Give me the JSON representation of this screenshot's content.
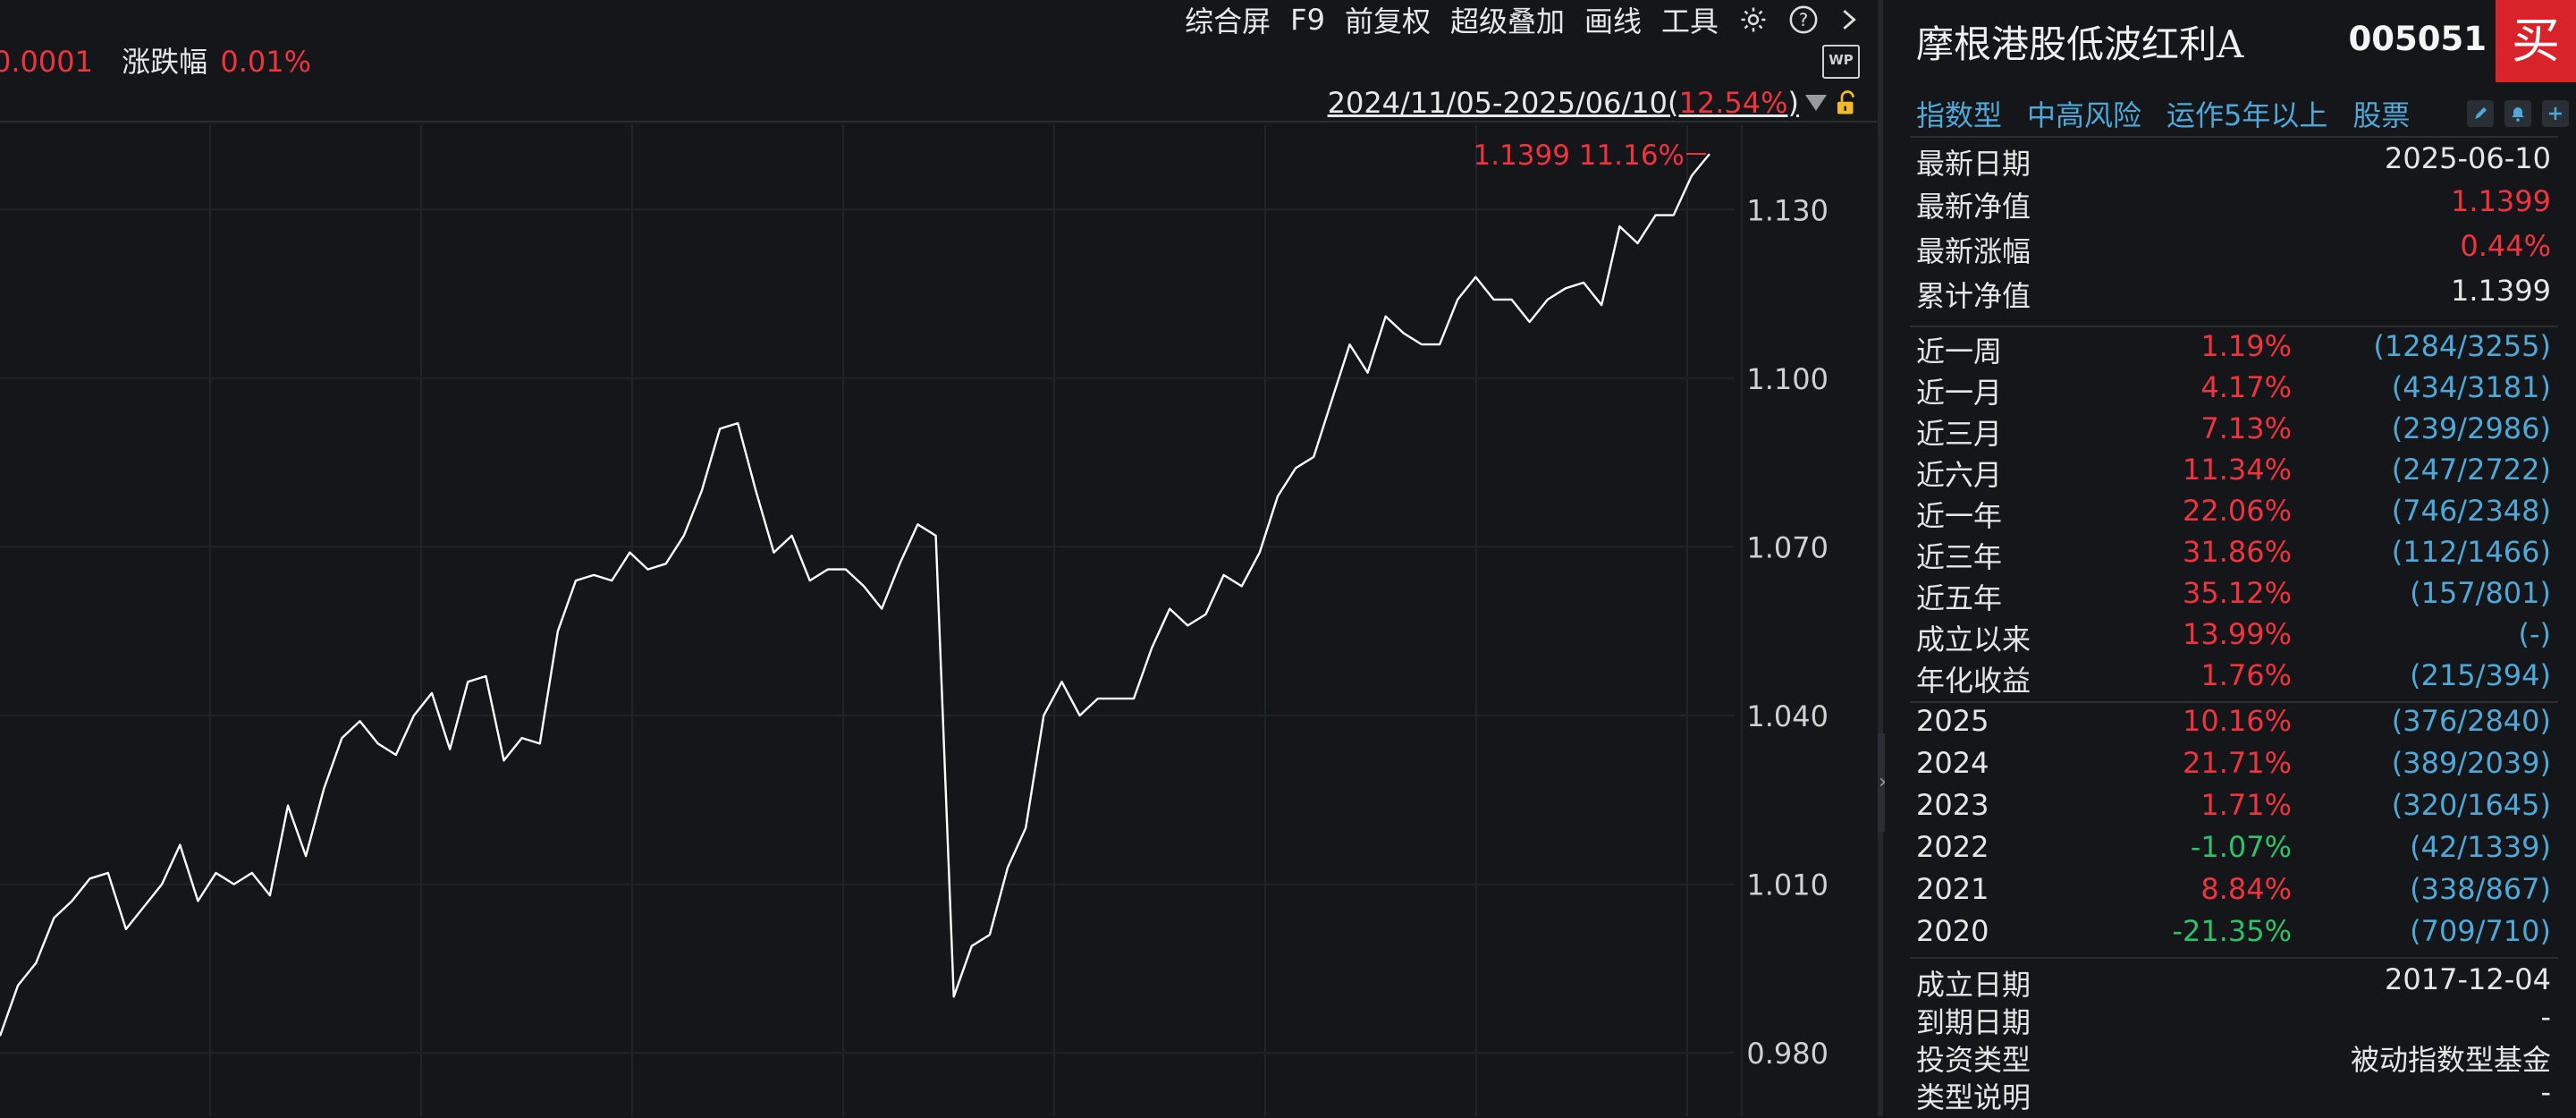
{
  "toolbar": {
    "items": [
      "综合屏",
      "F9",
      "前复权",
      "超级叠加",
      "画线",
      "工具"
    ]
  },
  "stats_line": {
    "value_label": "0.0001",
    "change_label": "涨跌幅",
    "change_value": "0.01%"
  },
  "wp_badge": "WP",
  "range": {
    "dates": "2024/11/05-2025/06/10(",
    "pct": "12.54%",
    "close": ")"
  },
  "chart_data": {
    "type": "line",
    "ylim": [
      0.97,
      1.145
    ],
    "yticks": [
      "1.130",
      "1.100",
      "1.070",
      "1.040",
      "1.010",
      "0.980"
    ],
    "ytick_values": [
      1.13,
      1.1,
      1.07,
      1.04,
      1.01,
      0.98
    ],
    "last_label": "1.1399 11.16%",
    "series": [
      {
        "values": [
          0.983,
          0.992,
          0.996,
          1.004,
          1.007,
          1.011,
          1.012,
          1.002,
          1.006,
          1.01,
          1.017,
          1.007,
          1.012,
          1.01,
          1.012,
          1.008,
          1.024,
          1.015,
          1.027,
          1.036,
          1.039,
          1.035,
          1.033,
          1.04,
          1.044,
          1.034,
          1.046,
          1.047,
          1.032,
          1.036,
          1.035,
          1.055,
          1.064,
          1.065,
          1.064,
          1.069,
          1.066,
          1.067,
          1.072,
          1.08,
          1.091,
          1.092,
          1.08,
          1.069,
          1.072,
          1.064,
          1.066,
          1.066,
          1.063,
          1.059,
          1.067,
          1.074,
          1.072,
          0.99,
          0.999,
          1.001,
          1.013,
          1.02,
          1.04,
          1.046,
          1.04,
          1.043,
          1.043,
          1.043,
          1.052,
          1.059,
          1.056,
          1.058,
          1.065,
          1.063,
          1.069,
          1.079,
          1.084,
          1.086,
          1.096,
          1.106,
          1.101,
          1.111,
          1.108,
          1.106,
          1.106,
          1.114,
          1.118,
          1.114,
          1.114,
          1.11,
          1.114,
          1.116,
          1.117,
          1.113,
          1.127,
          1.124,
          1.129,
          1.129,
          1.136,
          1.1399
        ]
      }
    ]
  },
  "fund": {
    "name": "摩根港股低波红利A",
    "code": "005051",
    "buy": "买",
    "tags": [
      "指数型",
      "中高风险",
      "运作5年以上",
      "股票"
    ]
  },
  "summary": [
    {
      "k": "最新日期",
      "v": "2025-06-10",
      "color": "#e6e6e6"
    },
    {
      "k": "最新净值",
      "v": "1.1399",
      "color": "#f0343f"
    },
    {
      "k": "最新涨幅",
      "v": "0.44%",
      "color": "#f0343f"
    },
    {
      "k": "累计净值",
      "v": "1.1399",
      "color": "#e6e6e6"
    }
  ],
  "periods": [
    {
      "k": "近一周",
      "p": "1.19%",
      "r": "(1284/3255)",
      "color": "#f0343f"
    },
    {
      "k": "近一月",
      "p": "4.17%",
      "r": "(434/3181)",
      "color": "#f0343f"
    },
    {
      "k": "近三月",
      "p": "7.13%",
      "r": "(239/2986)",
      "color": "#f0343f"
    },
    {
      "k": "近六月",
      "p": "11.34%",
      "r": "(247/2722)",
      "color": "#f0343f"
    },
    {
      "k": "近一年",
      "p": "22.06%",
      "r": "(746/2348)",
      "color": "#f0343f"
    },
    {
      "k": "近三年",
      "p": "31.86%",
      "r": "(112/1466)",
      "color": "#f0343f"
    },
    {
      "k": "近五年",
      "p": "35.12%",
      "r": "(157/801)",
      "color": "#f0343f"
    },
    {
      "k": "成立以来",
      "p": "13.99%",
      "r": "(-)",
      "color": "#f0343f"
    },
    {
      "k": "年化收益",
      "p": "1.76%",
      "r": "(215/394)",
      "color": "#f0343f"
    }
  ],
  "years": [
    {
      "k": "2025",
      "p": "10.16%",
      "r": "(376/2840)",
      "color": "#f0343f"
    },
    {
      "k": "2024",
      "p": "21.71%",
      "r": "(389/2039)",
      "color": "#f0343f"
    },
    {
      "k": "2023",
      "p": "1.71%",
      "r": "(320/1645)",
      "color": "#f0343f"
    },
    {
      "k": "2022",
      "p": "-1.07%",
      "r": "(42/1339)",
      "color": "#2ec26a"
    },
    {
      "k": "2021",
      "p": "8.84%",
      "r": "(338/867)",
      "color": "#f0343f"
    },
    {
      "k": "2020",
      "p": "-21.35%",
      "r": "(709/710)",
      "color": "#2ec26a"
    }
  ],
  "details": [
    {
      "k": "成立日期",
      "v": "2017-12-04"
    },
    {
      "k": "到期日期",
      "v": "-"
    },
    {
      "k": "投资类型",
      "v": "被动指数型基金"
    },
    {
      "k": "类型说明",
      "v": "-"
    }
  ]
}
